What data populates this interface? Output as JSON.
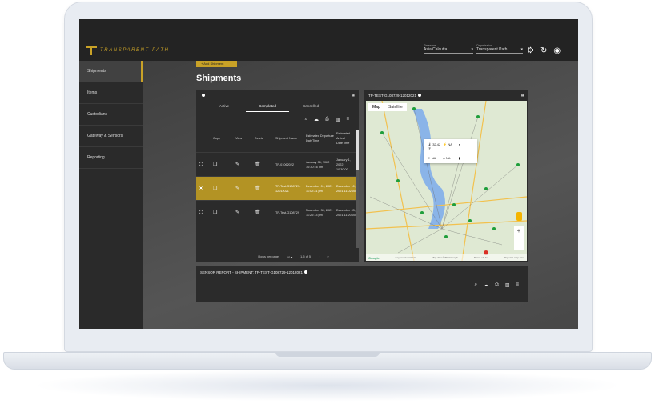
{
  "brand": {
    "name": "TRANSPARENT PATH",
    "accent": "#c9a227"
  },
  "header": {
    "timezone": {
      "label": "Timezone",
      "value": "Asia/Calcutta"
    },
    "organization": {
      "label": "Organization",
      "value": "Transparent Path"
    },
    "icons": [
      "gear-icon",
      "refresh-icon",
      "account-icon"
    ]
  },
  "sidebar": {
    "items": [
      {
        "label": "Shipments",
        "active": true
      },
      {
        "label": "Items"
      },
      {
        "label": "Custodians"
      },
      {
        "label": "Gateway & Sensors"
      },
      {
        "label": "Reporting"
      }
    ]
  },
  "main": {
    "add_button": "+ Add Shipment",
    "title": "Shipments"
  },
  "shipments_panel": {
    "tabs": [
      "Active",
      "Completed",
      "Cancelled"
    ],
    "active_tab": "Completed",
    "columns": [
      "Copy",
      "View",
      "Delete",
      "Shipment Name",
      "Estimated Departure DateTime",
      "Estimated Arrival DateTime"
    ],
    "rows": [
      {
        "name": "TP-01062022",
        "departure": "January 06, 2022 10:30:16 pm",
        "arrival": "January 1, 2022 10:30:00"
      },
      {
        "name": "TP-Test-G108729-12012021",
        "departure": "December 01, 2021 11:02:31 pm",
        "arrival": "December 10, 2021 11:02:00",
        "selected": true
      },
      {
        "name": "TP-Test-G108729",
        "departure": "November 30, 2021 11:20:13 pm",
        "arrival": "December 03, 2021 11:20:00"
      }
    ],
    "pager": {
      "rows_per_page_label": "Rows per page",
      "rows_per_page": "10",
      "range": "1-5 of 5"
    }
  },
  "map_panel": {
    "title": "TP-TEST-G108729-12012021",
    "tabs": [
      "Map",
      "Satellite"
    ],
    "info": {
      "temperature": "32.42 °F",
      "shock": "NA",
      "light": "NA",
      "humidity": "NA"
    },
    "footer": [
      "Google",
      "Keyboard shortcuts",
      "Map data ©2022 Google",
      "Terms of Use",
      "Report a map error"
    ]
  },
  "sensor_panel": {
    "title": "SENSOR REPORT - SHIPMENT: TP-TEST-G108729-12012021"
  }
}
